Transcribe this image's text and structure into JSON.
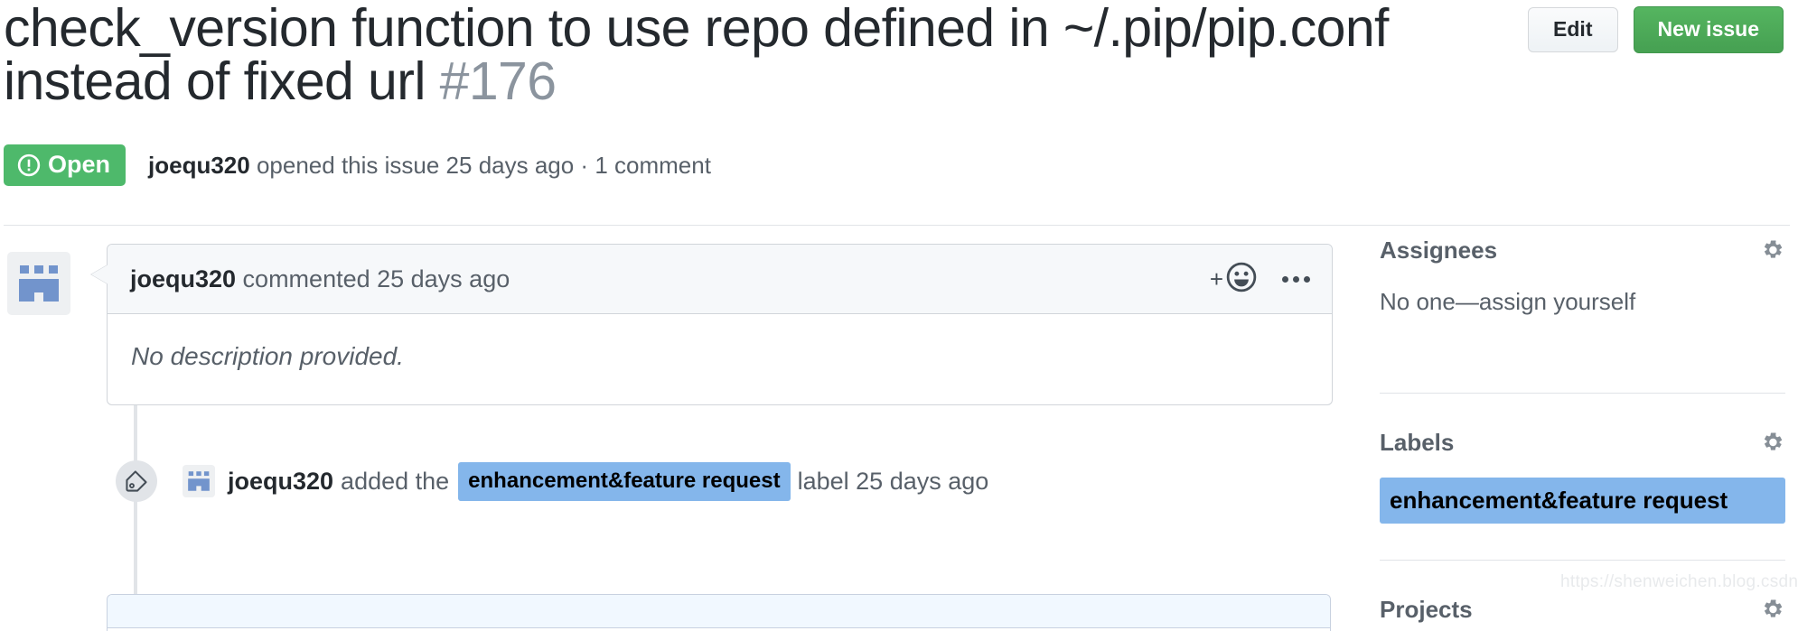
{
  "header": {
    "title_text": "check_version function to use repo defined in ~/.pip/pip.conf instead of fixed url",
    "issue_number": "#176",
    "edit_button": "Edit",
    "new_issue_button": "New issue"
  },
  "meta": {
    "state": "Open",
    "state_color": "#4eb96b",
    "author": "joequ320",
    "text": " opened this issue 25 days ago · 1 comment"
  },
  "comment": {
    "author": "joequ320",
    "header_suffix": " commented 25 days ago",
    "body": "No description provided.",
    "add_reaction_plus": "+",
    "add_reaction_emoji": "smiley-icon",
    "menu": "kebab-menu-icon"
  },
  "event": {
    "author": "joequ320",
    "action": "added the",
    "label": "enhancement&feature request",
    "suffix": "label 25 days ago"
  },
  "sidebar": {
    "assignees": {
      "title": "Assignees",
      "value": "No one—assign yourself"
    },
    "labels": {
      "title": "Labels",
      "items": [
        {
          "name": "enhancement&feature request",
          "color": "#84b6eb"
        }
      ]
    },
    "projects": {
      "title": "Projects"
    }
  },
  "watermark": "https://shenweichen.blog.csdn.net"
}
